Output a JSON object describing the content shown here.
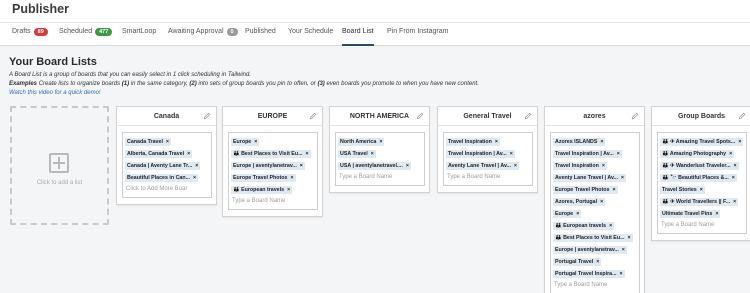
{
  "app": {
    "title": "Publisher"
  },
  "tabs": [
    {
      "label": "Drafts",
      "badge": "89",
      "badge_color": "#d9383b"
    },
    {
      "label": "Scheduled",
      "badge": "477",
      "badge_color": "#3c9a47"
    },
    {
      "label": "SmartLoop",
      "badge": null
    },
    {
      "label": "Awaiting Approval",
      "badge": "0",
      "badge_color": "#9a9a9a"
    },
    {
      "label": "Published",
      "badge": null
    },
    {
      "label": "Your Schedule",
      "badge": null
    },
    {
      "label": "Board List",
      "badge": null,
      "active": true
    },
    {
      "label": "Pin From Instagram",
      "badge": null
    }
  ],
  "page": {
    "title": "Your Board Lists",
    "description_line1": "A Board List is a group of boards that you can easily select in 1 click scheduling in Tailwind.",
    "examples_label": "Examples",
    "examples_part1": " Create lists to organize boards ",
    "examples_n1": "(1)",
    "examples_part2": " in the same category, ",
    "examples_n2": "(2)",
    "examples_part3": " into sets of group boards you pin to often, or ",
    "examples_n3": "(3)",
    "examples_part4": " even boards you promote to when you have new content.",
    "video_link": "Watch this video for a quick demo!"
  },
  "add_list": {
    "label": "Click to add a list"
  },
  "lists": [
    {
      "name": "Canada",
      "boards": [
        "Canada Travel",
        "Alberta, Canada Travel",
        "Canada | Aventy Lane Tr...",
        "Beautiful Places in Can..."
      ],
      "placeholder": "Click to Add More Boar"
    },
    {
      "name": "EUROPE",
      "boards": [
        "Europe",
        "👪 Best Places to Visit Eu...",
        "Europe | aventylanetrav...",
        "Europe Travel Photos",
        "👪 European travels"
      ],
      "placeholder": "Type a Board Name"
    },
    {
      "name": "NORTH AMERICA",
      "boards": [
        "North America",
        "USA Travel",
        "USA | aventylanetravel...."
      ],
      "placeholder": "Type a Board Name"
    },
    {
      "name": "General Travel",
      "boards": [
        "Travel Inspiration",
        "Travel Inspiration | Av...",
        "Aventy Lane Travel | Av..."
      ],
      "placeholder": "Type a Board Name"
    },
    {
      "name": "azores",
      "boards": [
        "Azores ISLANDS",
        "Travel Inspiration | Av...",
        "Travel Inspiration",
        "Aventy Lane Travel | Av...",
        "Europe Travel Photos",
        "Azores, Portugal",
        "Europe",
        "👪 European travels",
        "👪 Best Places to Visit Eu...",
        "Europe | aventylanetrav...",
        "Portugal Travel",
        "Portugal Travel Inspira..."
      ],
      "placeholder": "Type a Board Name"
    },
    {
      "name": "Group Boards",
      "boards": [
        "👪 ✈ Amazing Travel Spots...",
        "👪 Amazing Photography",
        "👪 ✈ Wanderlust Traveler...",
        "👪 🔭 Beautiful Places &...",
        "Travel Stories",
        "👪 ✈ World Travellers || F...",
        "Ultimate Travel Pins"
      ],
      "placeholder": "Type a Board Name"
    }
  ],
  "icons": {
    "edit": "pencil-icon",
    "remove": "close-icon",
    "add": "plus-icon"
  },
  "colors": {
    "tag_bg": "#dfe9f2",
    "active_tab_underline": "#2a4d6e",
    "link": "#2a6fb3"
  }
}
